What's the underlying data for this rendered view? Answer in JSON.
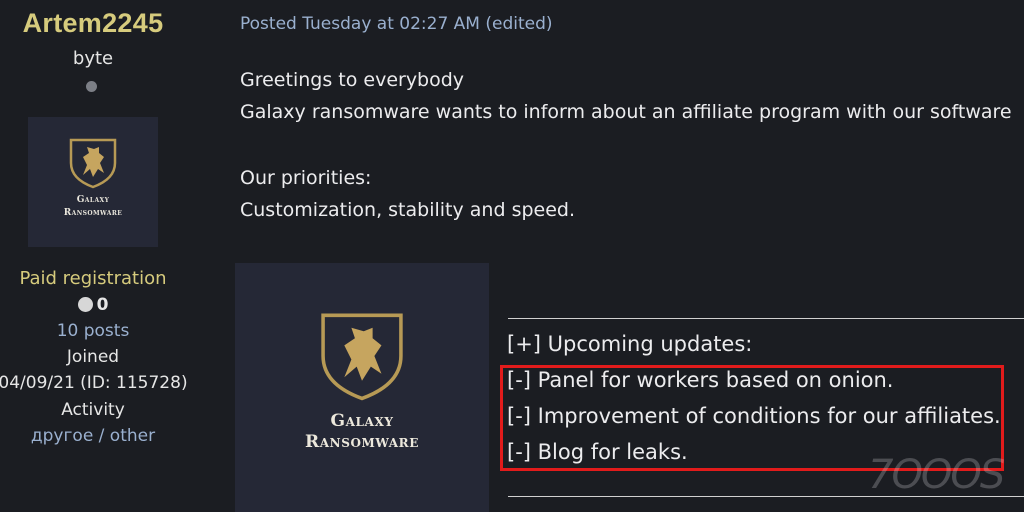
{
  "profile": {
    "username": "Artem2245",
    "rank": "byte",
    "avatar_logo_text_line1": "Galaxy",
    "avatar_logo_text_line2": "Ransomware",
    "group": "Paid registration",
    "reputation": "0",
    "posts": "10 posts",
    "joined_label": "Joined",
    "joined_value": "04/09/21 (ID: 115728)",
    "activity_label": "Activity",
    "activity_value": "другое / other"
  },
  "post": {
    "posted_meta": "Posted Tuesday at 02:27 AM (edited)",
    "lines": [
      "Greetings to everybody",
      "Galaxy ransomware wants to inform about an affiliate program with our software",
      "Our priorities:",
      "Customization, stability and speed."
    ],
    "banner_text_line1": "Galaxy",
    "banner_text_line2": "Ransomware",
    "updates": [
      "[+] Upcoming updates:",
      "[-] Panel for workers based on onion.",
      "[-] Improvement of conditions for our affiliates.",
      "[-] Blog for leaks."
    ]
  },
  "watermark": "7OOOS",
  "colors": {
    "background": "#1b1d22",
    "username": "#d6cb7d",
    "link": "#9ab0cf",
    "highlight_box": "#e21b1b"
  }
}
